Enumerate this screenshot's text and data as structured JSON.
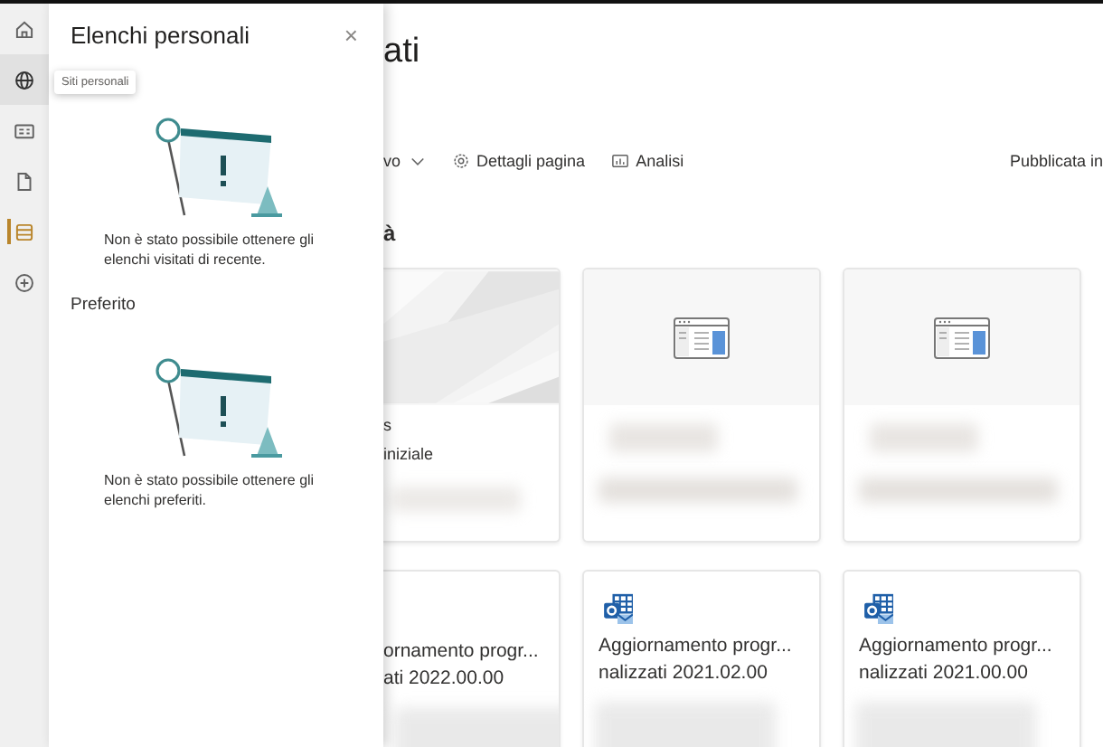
{
  "rail": {
    "items": [
      {
        "kind": "home",
        "selected": false,
        "hovered": false
      },
      {
        "kind": "globe",
        "selected": false,
        "hovered": true
      },
      {
        "kind": "news",
        "selected": false,
        "hovered": false
      },
      {
        "kind": "file",
        "selected": false,
        "hovered": false
      },
      {
        "kind": "lists",
        "selected": true,
        "hovered": false
      },
      {
        "kind": "add",
        "selected": false,
        "hovered": false
      }
    ]
  },
  "tooltip": {
    "text": "Siti personali"
  },
  "panel": {
    "title": "Elenchi personali",
    "close": "×",
    "sections": [
      {
        "message": "Non è stato possibile ottenere gli elenchi visitati di recente."
      },
      {
        "heading": "Preferito",
        "message": "Non è stato possibile ottenere gli elenchi preferiti."
      }
    ]
  },
  "page": {
    "title": "ati",
    "toolbar": [
      {
        "kind": "dropdown",
        "label": "vo"
      },
      {
        "kind": "settings",
        "label": "Dettagli pagina"
      },
      {
        "kind": "analytics",
        "label": "Analisi"
      }
    ],
    "published": "Pubblicata in",
    "section_heading": "à",
    "cards": [
      {
        "kind": "picture",
        "lines": [
          "s",
          "iniziale"
        ]
      },
      {
        "kind": "page"
      },
      {
        "kind": "page"
      },
      {
        "kind": "text",
        "lines": [
          "ornamento progr...",
          "ati 2022.00.00"
        ]
      },
      {
        "kind": "post",
        "lines": [
          "Aggiornamento progr...",
          "nalizzati 2021.02.00"
        ]
      },
      {
        "kind": "post",
        "lines": [
          "Aggiornamento progr...",
          "nalizzati 2021.00.00"
        ]
      }
    ]
  }
}
